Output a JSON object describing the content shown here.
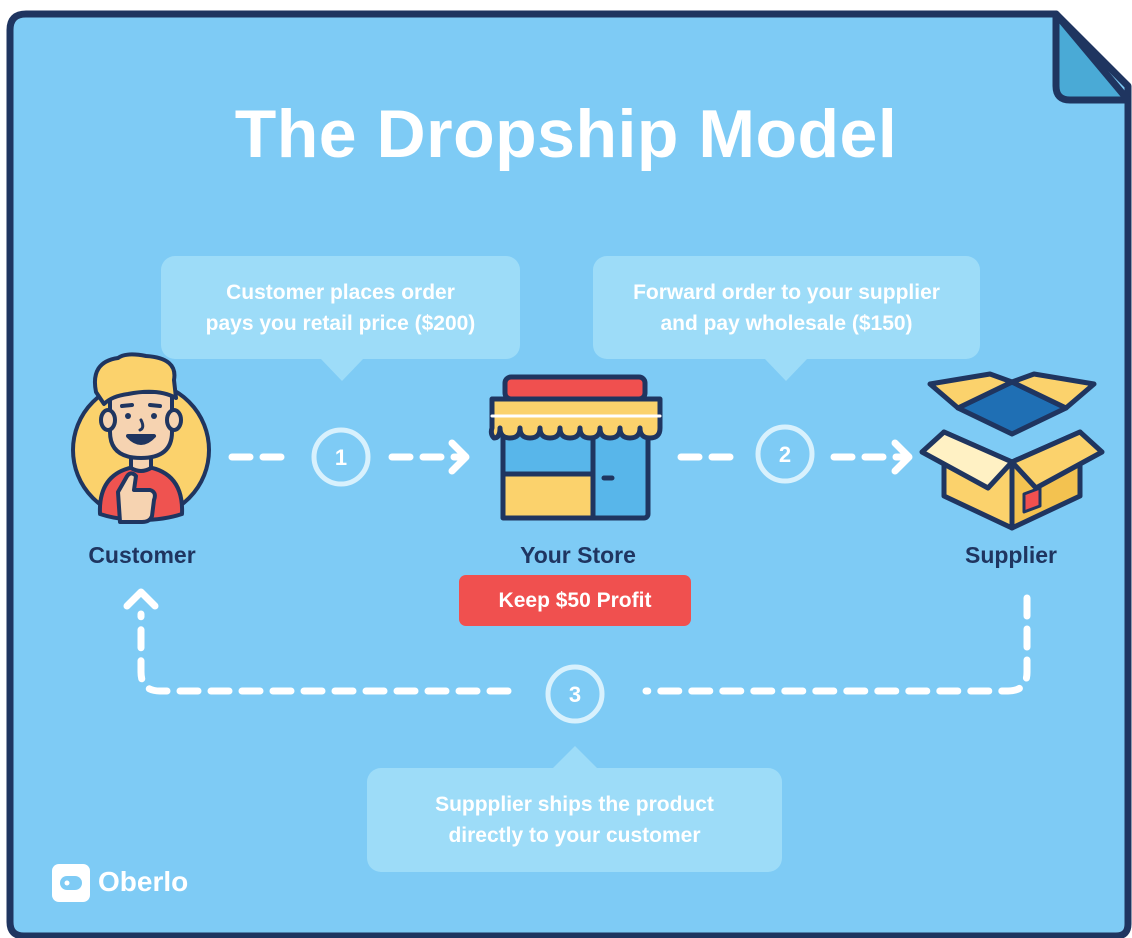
{
  "title": "The Dropship Model",
  "steps": [
    {
      "number": "1",
      "lines": [
        "Customer places order",
        "pays you retail price ($200)"
      ]
    },
    {
      "number": "2",
      "lines": [
        "Forward order to your supplier",
        "and pay wholesale ($150)"
      ]
    },
    {
      "number": "3",
      "lines": [
        "Suppplier ships the product",
        "directly to your customer"
      ]
    }
  ],
  "actors": {
    "customer": "Customer",
    "store": "Your Store",
    "supplier": "Supplier"
  },
  "profit_badge": "Keep $50 Profit",
  "brand": "Oberlo",
  "colors": {
    "background": "#7ecbf5",
    "border": "#1f3560",
    "bubble": "#9ddcf8",
    "profit": "#f0504f",
    "corner_fold": "#4aaad6",
    "text_dark": "#1f3560",
    "text_light": "#ffffff"
  }
}
